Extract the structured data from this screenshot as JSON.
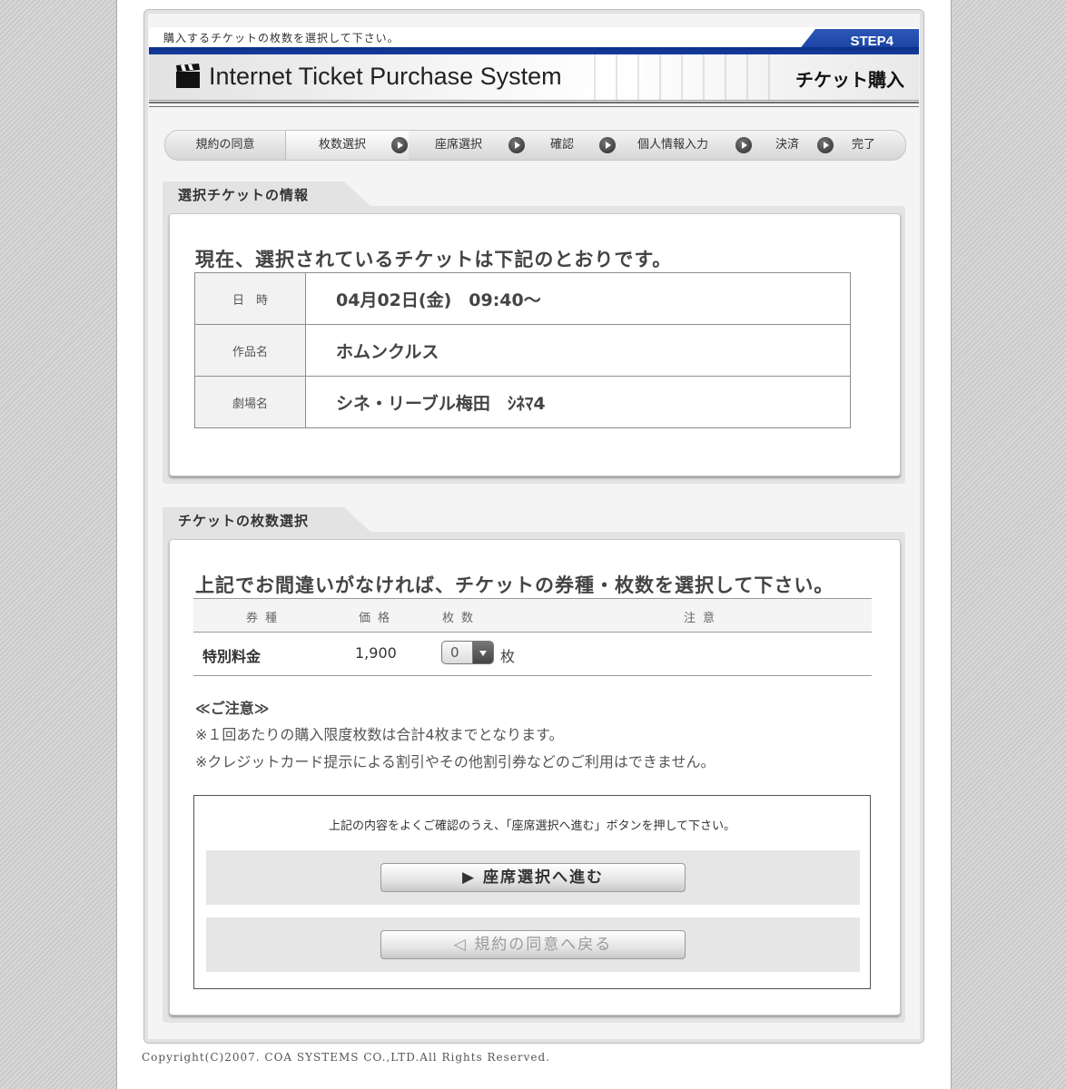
{
  "header": {
    "instruction": "購入するチケットの枚数を選択して下さい。",
    "step": "STEP4",
    "system_title": "Internet Ticket Purchase System",
    "page_label": "チケット購入",
    "icon": "clapperboard-icon"
  },
  "progress": {
    "steps": [
      "規約の同意",
      "枚数選択",
      "座席選択",
      "確認",
      "個人情報入力",
      "決済",
      "完了"
    ],
    "current": "枚数選択"
  },
  "selected_ticket": {
    "section_title": "選択チケットの情報",
    "lead": "現在、選択されているチケットは下記のとおりです。",
    "rows": [
      {
        "label": "日　時",
        "value": "04月02日(金)　09:40〜"
      },
      {
        "label": "作品名",
        "value": "ホムンクルス"
      },
      {
        "label": "劇場名",
        "value": "シネ・リーブル梅田　ｼﾈﾏ4"
      }
    ]
  },
  "quantity": {
    "section_title": "チケットの枚数選択",
    "lead": "上記でお間違いがなければ、チケットの券種・枚数を選択して下さい。",
    "columns": [
      "券種",
      "価格",
      "枚数",
      "注意"
    ],
    "ticket": {
      "type": "特別料金",
      "price": "1,900",
      "count": "0",
      "unit": "枚"
    },
    "notes_title": "≪ご注意≫",
    "notes": [
      "※１回あたりの購入限度枚数は合計4枚までとなります。",
      "※クレジットカード提示による割引やその他割引券などのご利用はできません。"
    ]
  },
  "confirm": {
    "text": "上記の内容をよくご確認のうえ、「座席選択へ進む」ボタンを押して下さい。",
    "next_label": "▶ 座席選択へ進む",
    "back_label": "◁ 規約の同意へ戻る"
  },
  "footer": {
    "copyright": "Copyright(C)2007. COA SYSTEMS CO.,LTD.All Rights Reserved."
  }
}
